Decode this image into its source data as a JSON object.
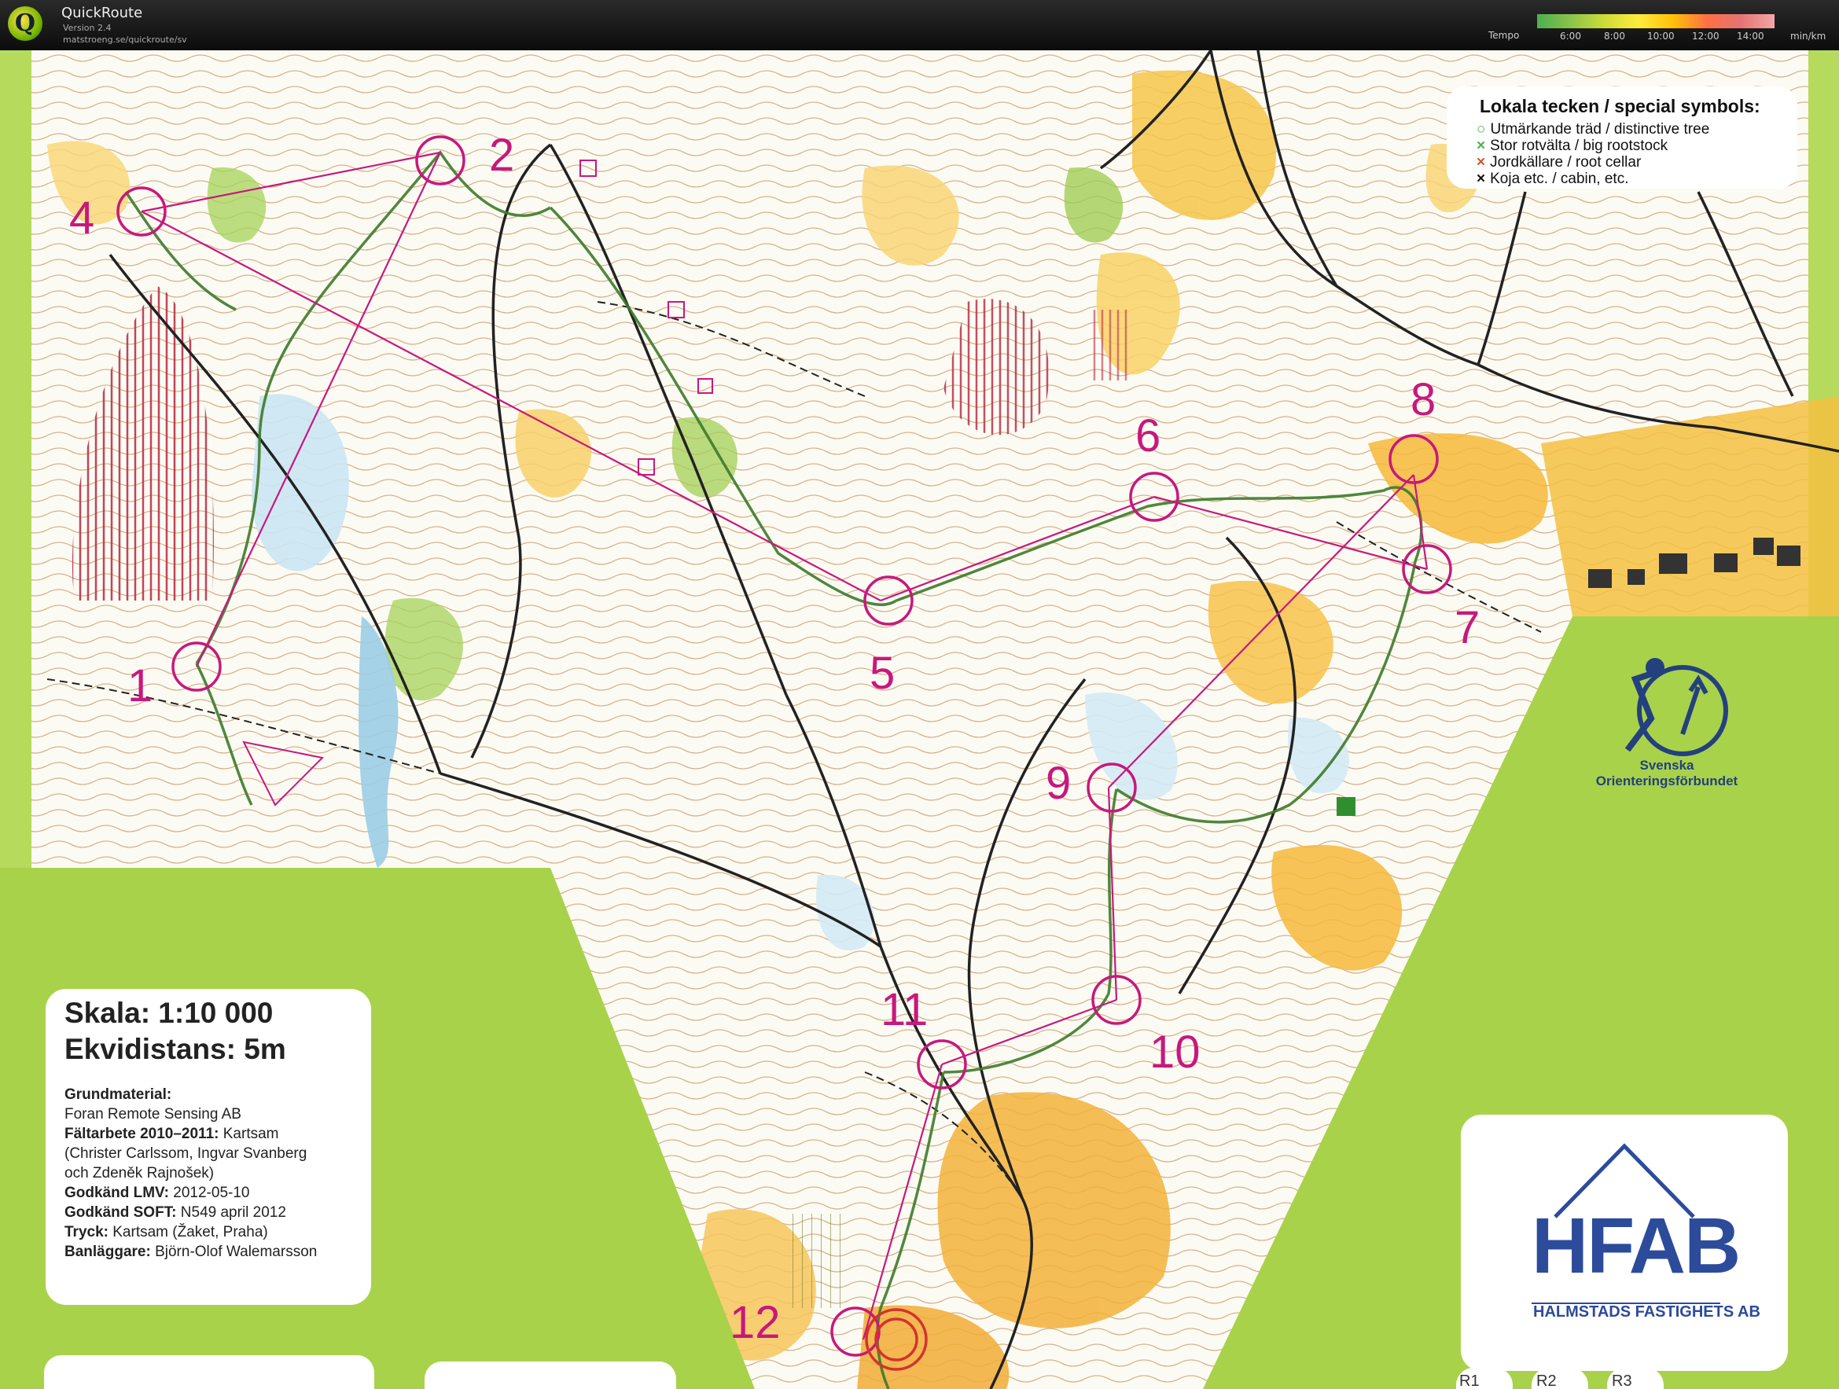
{
  "app": {
    "name": "QuickRoute",
    "version": "Version 2.4",
    "url": "matstroeng.se/quickroute/sv"
  },
  "tempo_scale": {
    "label": "Tempo",
    "ticks": [
      "6:00",
      "8:00",
      "10:00",
      "12:00",
      "14:00"
    ],
    "unit": "min/km"
  },
  "map": {
    "controls": [
      "1",
      "2",
      "4",
      "5",
      "6",
      "7",
      "8",
      "9",
      "10",
      "11",
      "12"
    ],
    "legend": {
      "title": "Lokala tecken / special symbols:",
      "items": [
        {
          "symbol": "○",
          "color": "#4caf50",
          "text": "Utmärkande träd / distinctive tree"
        },
        {
          "symbol": "×",
          "color": "#4caf50",
          "text": "Stor rotvälta / big rootstock"
        },
        {
          "symbol": "×",
          "color": "#c65a2e",
          "text": "Jordkällare / root cellar"
        },
        {
          "symbol": "×",
          "color": "#111111",
          "text": "Koja etc. / cabin, etc."
        }
      ]
    },
    "info": {
      "scale": "Skala: 1:10 000",
      "contour": "Ekvidistans: 5m",
      "lines": [
        {
          "label": "Grundmaterial:",
          "value": ""
        },
        {
          "label": "",
          "value": "Foran Remote Sensing AB"
        },
        {
          "label": "Fältarbete 2010–2011:",
          "value": " Kartsam"
        },
        {
          "label": "",
          "value": "(Christer Carlssom, Ingvar Svanberg"
        },
        {
          "label": "",
          "value": "och Zdeněk Rajnošek)"
        },
        {
          "label": "Godkänd LMV:",
          "value": " 2012-05-10"
        },
        {
          "label": "Godkänd SOFT:",
          "value": " N549 april 2012"
        },
        {
          "label": "Tryck:",
          "value": " Kartsam (Žaket, Praha)"
        },
        {
          "label": "Banläggare:",
          "value": " Björn-Olof Walemarsson"
        }
      ]
    },
    "sponsor": {
      "logo": "HFAB",
      "name": "HALMSTADS FASTIGHETS AB"
    },
    "federation": "Svenska Orienteringsförbundet",
    "bottom_tabs": [
      "R1",
      "R2",
      "R3"
    ],
    "colors": {
      "course": "#c7187d",
      "route": "#3d7a2a",
      "open_land": "#f6c64a",
      "forest_green": "#9acd3c",
      "water": "#c7e3f1",
      "border_green": "#a8d24a"
    }
  }
}
